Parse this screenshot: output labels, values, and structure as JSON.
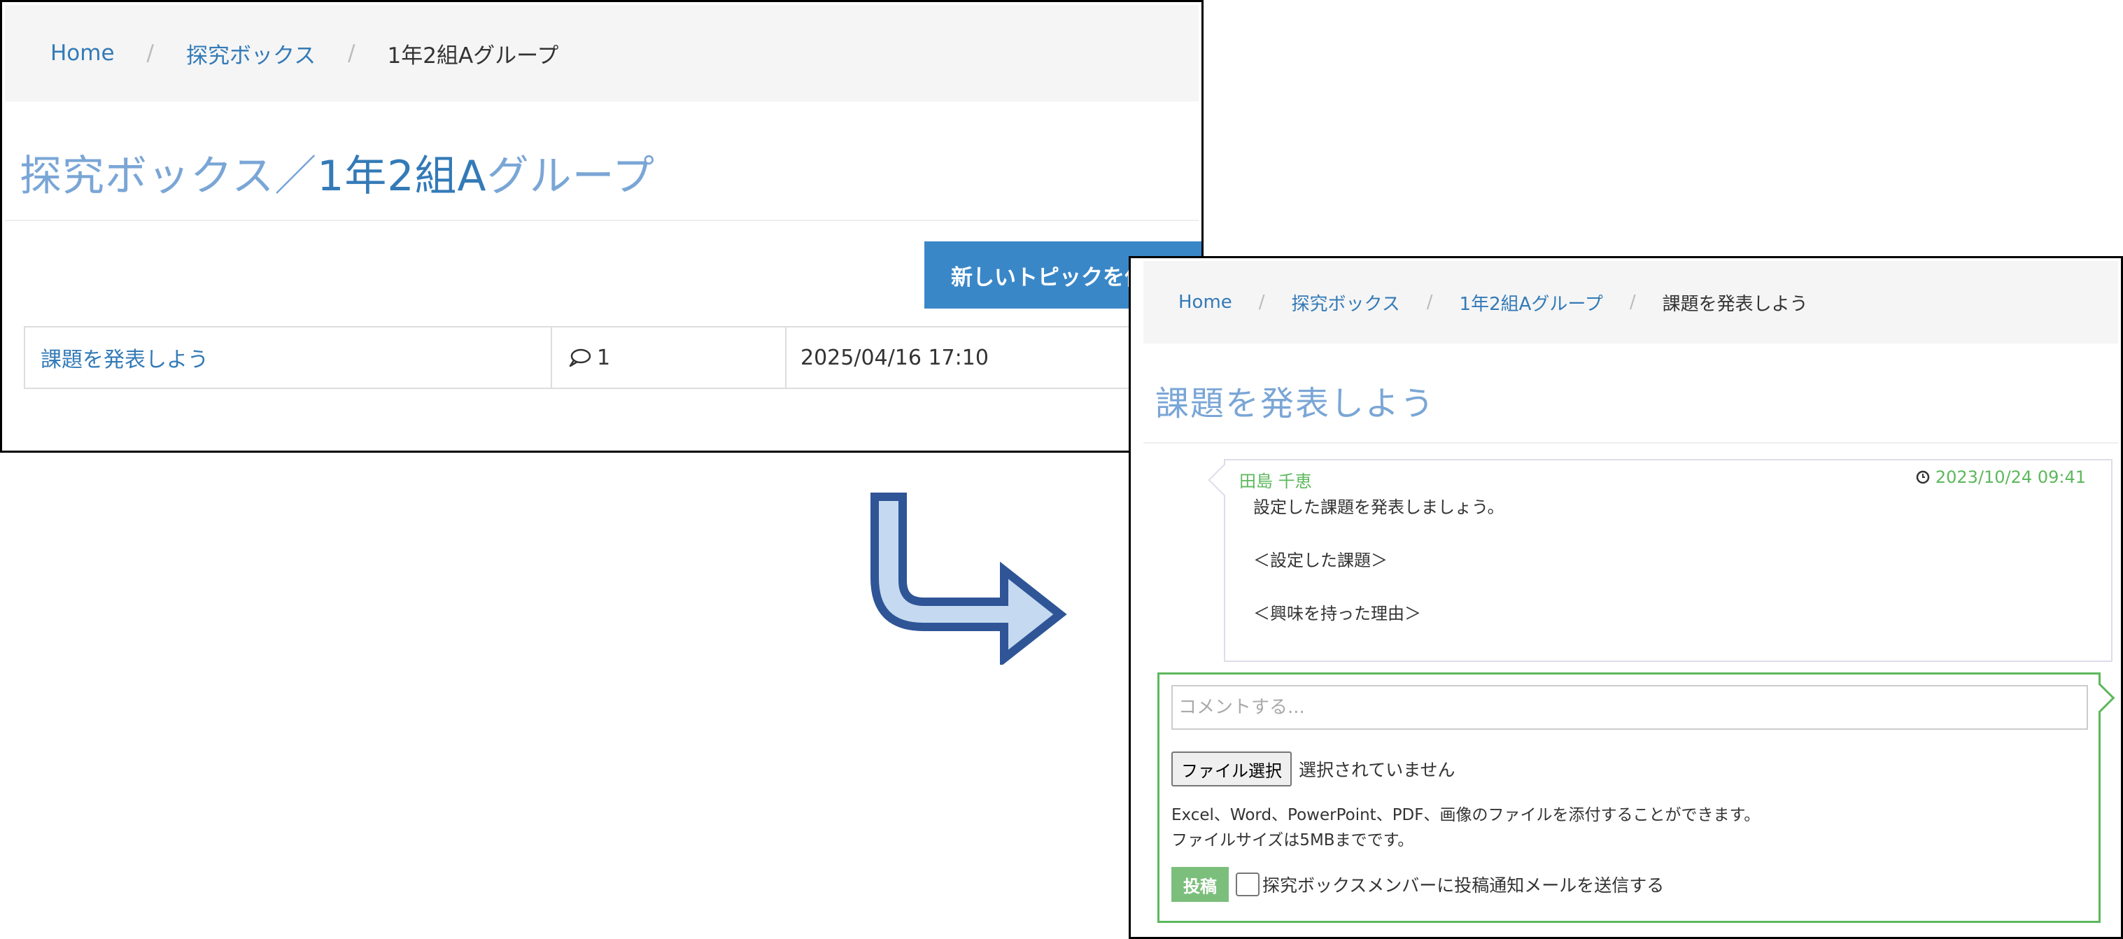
{
  "panel1": {
    "breadcrumb": [
      {
        "label": "Home"
      },
      {
        "label": "探究ボックス"
      },
      {
        "label": "1年2組Aグループ"
      }
    ],
    "title_prefix": "探究ボックス／",
    "title_group": "1年2組A",
    "title_suffix": "グループ",
    "new_topic_button": "新しいトピックを作",
    "topics": [
      {
        "title": "課題を発表しよう",
        "comment_count": "1",
        "datetime": "2025/04/16 17:10"
      }
    ]
  },
  "panel2": {
    "breadcrumb": [
      {
        "label": "Home"
      },
      {
        "label": "探究ボックス"
      },
      {
        "label": "1年2組Aグループ"
      },
      {
        "label": "課題を発表しよう"
      }
    ],
    "title": "課題を発表しよう",
    "post": {
      "author": "田島 千恵",
      "datetime": "2023/10/24 09:41",
      "lines": [
        "設定した課題を発表しましょう。",
        "",
        "＜設定した課題＞",
        "",
        "＜興味を持った理由＞"
      ]
    },
    "comment_form": {
      "placeholder": "コメントする...",
      "file_button": "ファイル選択",
      "file_status": "選択されていません",
      "note_line1": "Excel、Word、PowerPoint、PDF、画像のファイルを添付することができます。",
      "note_line2": "ファイルサイズは5MBまでです。",
      "submit": "投稿",
      "notify_label": "探究ボックスメンバーに投稿通知メールを送信する"
    }
  },
  "icons": {
    "comment": "comment-bubble-icon",
    "clock": "clock-icon",
    "arrow": "down-right-arrow-icon"
  },
  "colors": {
    "link": "#337ab7",
    "title": "#7aa6d6",
    "button_primary": "#3a87c8",
    "success": "#5cb85c",
    "arrow_fill": "#c5d9f0",
    "arrow_stroke": "#2f5597"
  }
}
